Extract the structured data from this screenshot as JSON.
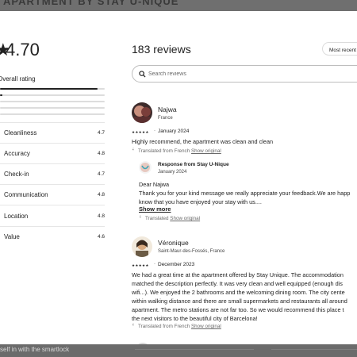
{
  "backdrop": {
    "top_title": "APARTMENT BY STAY U-NIQUE",
    "bottom_text": "self in with the smartlock"
  },
  "summary": {
    "star": "★",
    "overall_value": "4.70",
    "overall_label": "Overall rating",
    "rating_distribution": [
      0.93,
      0.02,
      0.0,
      0.0,
      0.0
    ],
    "categories": [
      {
        "label": "Cleanliness",
        "value": "4.7"
      },
      {
        "label": "Accuracy",
        "value": "4.8"
      },
      {
        "label": "Check-in",
        "value": "4.7"
      },
      {
        "label": "Communication",
        "value": "4.8"
      },
      {
        "label": "Location",
        "value": "4.8"
      },
      {
        "label": "Value",
        "value": "4.6"
      }
    ]
  },
  "reviews_header": {
    "title": "183 reviews",
    "sort_label": "Most recent",
    "search_placeholder": "Search reviews"
  },
  "reviews": [
    {
      "name": "Najwa",
      "location": "France",
      "stars": "★★★★★",
      "date": "January 2024",
      "text": [
        "Highly recommend, the apartment was clean and clean"
      ],
      "translated_label": "Translated from French",
      "show_original": "Show original",
      "response": {
        "title": "Response from Stay U-Nique",
        "date": "January 2024",
        "text": [
          "Dear Najwa",
          "Thank you for your kind message we really appreciate your feedback.We are happ",
          "know that you have enjoyed your stay with us...."
        ],
        "show_more": "Show more",
        "translated_label": "Translated",
        "show_original": "Show original"
      }
    },
    {
      "name": "Véronique",
      "location": "Saint-Maur-des-Fossés, France",
      "stars": "★★★★★",
      "date": "December 2023",
      "text": [
        "We had a great time at the apartment offered by Stay Unique. The accommodation",
        "matched the description perfectly. It was very clean and well equipped (enough dis",
        "wifi...). We enjoyed the 2 bathrooms and the welcoming dining room. The city cente",
        "within walking distance and there are small supermarkets and restaurants all around",
        "apartment. The metro stations are not far too. So we would recommend this place t",
        "the next visitors to the beautiful city of Barcelona!"
      ],
      "translated_label": "Translated from French",
      "show_original": "Show original"
    }
  ],
  "colors": {
    "text": "#222222",
    "muted": "#6a6a6a",
    "bar_track": "#dddddd",
    "backdrop": "#6b6b6b"
  }
}
